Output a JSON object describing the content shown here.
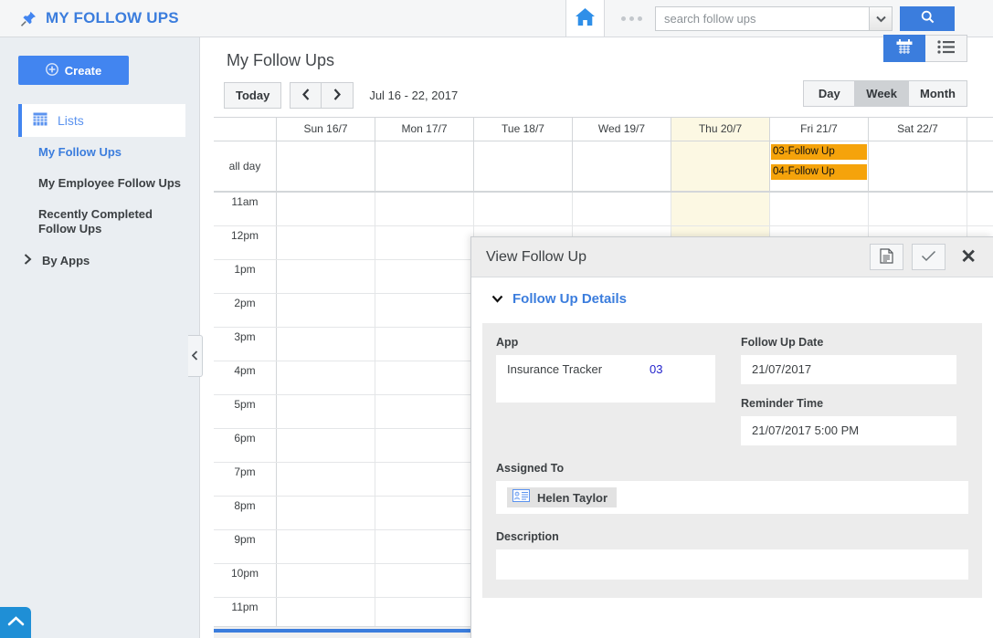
{
  "topbar": {
    "brand_title": "MY FOLLOW UPS",
    "pin_icon": "pin-icon",
    "home_icon": "home-icon",
    "overflow_icon": "ellipsis-icon",
    "search_placeholder": "search follow ups",
    "search_value": "",
    "search_caret_icon": "chevron-down-icon",
    "search_button_icon": "search-icon"
  },
  "sidebar": {
    "create_label": "Create",
    "create_icon": "plus-circle-icon",
    "lists_label": "Lists",
    "lists_icon": "grid-icon",
    "items": [
      {
        "label": "My Follow Ups",
        "active": true
      },
      {
        "label": "My Employee Follow Ups",
        "active": false
      },
      {
        "label": "Recently Completed Follow Ups",
        "active": false
      }
    ],
    "by_apps_label": "By Apps",
    "by_apps_icon": "chevron-right-icon",
    "collapse_icon": "chevron-left-icon",
    "scroll_top_icon": "chevron-up-icon"
  },
  "main": {
    "page_title": "My Follow Ups",
    "toolbar": {
      "today_label": "Today",
      "prev_icon": "chevron-left-icon",
      "next_icon": "chevron-right-icon",
      "range_label": "Jul 16 - 22, 2017",
      "view_toggle": [
        {
          "icon": "calendar-icon",
          "selected": true
        },
        {
          "icon": "list-icon",
          "selected": false
        }
      ],
      "periods": [
        {
          "label": "Day",
          "selected": false
        },
        {
          "label": "Week",
          "selected": true
        },
        {
          "label": "Month",
          "selected": false
        }
      ]
    }
  },
  "calendar": {
    "all_day_label": "all day",
    "days": [
      {
        "label": "Sun 16/7",
        "today": false
      },
      {
        "label": "Mon 17/7",
        "today": false
      },
      {
        "label": "Tue 18/7",
        "today": false
      },
      {
        "label": "Wed 19/7",
        "today": false
      },
      {
        "label": "Thu 20/7",
        "today": true
      },
      {
        "label": "Fri 21/7",
        "today": false
      },
      {
        "label": "Sat 22/7",
        "today": false
      }
    ],
    "all_day_events": [
      {
        "day_index": 5,
        "title": "03-Follow Up",
        "color": "#f5a30b"
      },
      {
        "day_index": 5,
        "title": "04-Follow Up",
        "color": "#f5a30b"
      }
    ],
    "hours": [
      "11am",
      "12pm",
      "1pm",
      "2pm",
      "3pm",
      "4pm",
      "5pm",
      "6pm",
      "7pm",
      "8pm",
      "9pm",
      "10pm",
      "11pm"
    ]
  },
  "modal": {
    "title": "View Follow Up",
    "header_buttons": [
      {
        "icon": "document-icon"
      },
      {
        "icon": "check-icon"
      }
    ],
    "close_icon": "close-icon",
    "section": {
      "toggle_icon": "chevron-down-icon",
      "title": "Follow Up Details"
    },
    "fields": {
      "app_label": "App",
      "app_name": "Insurance Tracker",
      "app_number": "03",
      "follow_up_date_label": "Follow Up Date",
      "follow_up_date_value": "21/07/2017",
      "reminder_time_label": "Reminder Time",
      "reminder_time_value": "21/07/2017 5:00 PM",
      "assigned_to_label": "Assigned To",
      "assigned_to_value": "Helen Taylor",
      "assigned_to_icon": "contact-card-icon",
      "description_label": "Description",
      "description_value": ""
    }
  },
  "colors": {
    "brand_blue": "#3b7ddd",
    "accent_blue": "#4285f0",
    "event_orange": "#f5a30b",
    "today_highlight": "#fcf8e3"
  }
}
